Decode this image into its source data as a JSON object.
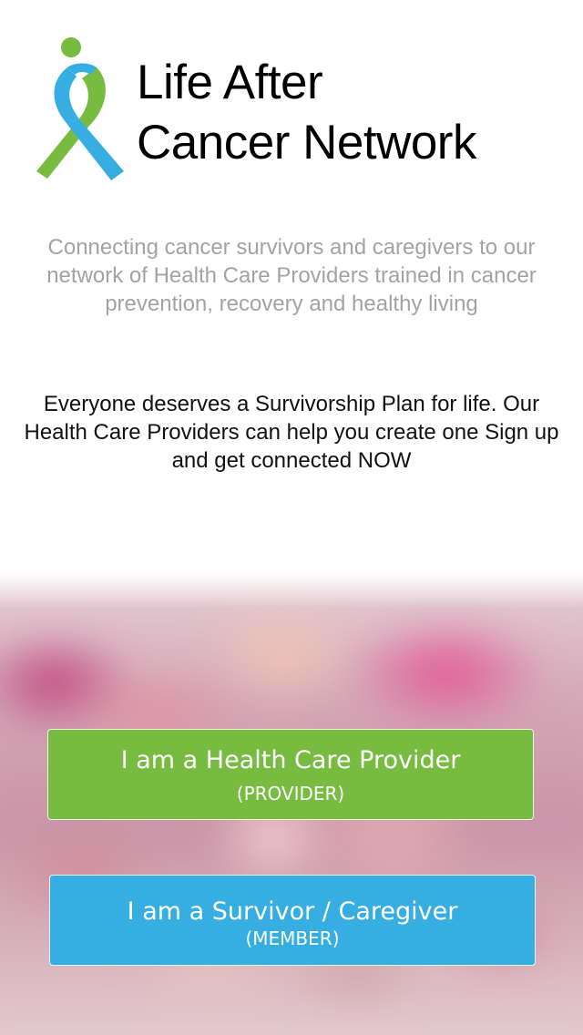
{
  "app": {
    "title_line1": "Life After",
    "title_line2": "Cancer Network",
    "logo_icon": "ribbon-figure-icon"
  },
  "tagline": "Connecting cancer survivors and caregivers to our network of Health Care Providers trained in cancer prevention, recovery and healthy living",
  "plan_message": "Everyone deserves a Survivorship Plan for life. Our Health Care Providers can help you create one Sign up and get connected NOW",
  "buttons": {
    "provider": {
      "label": "I am a Health Care Provider",
      "sub_label": "(PROVIDER)",
      "color": "#77bb41"
    },
    "member": {
      "label": "I am a Survivor / Caregiver",
      "sub_label": "(MEMBER)",
      "color": "#37aee2"
    }
  },
  "colors": {
    "logo_green": "#77bb41",
    "logo_blue": "#37aee2",
    "tagline_gray": "#a3a3a3"
  }
}
